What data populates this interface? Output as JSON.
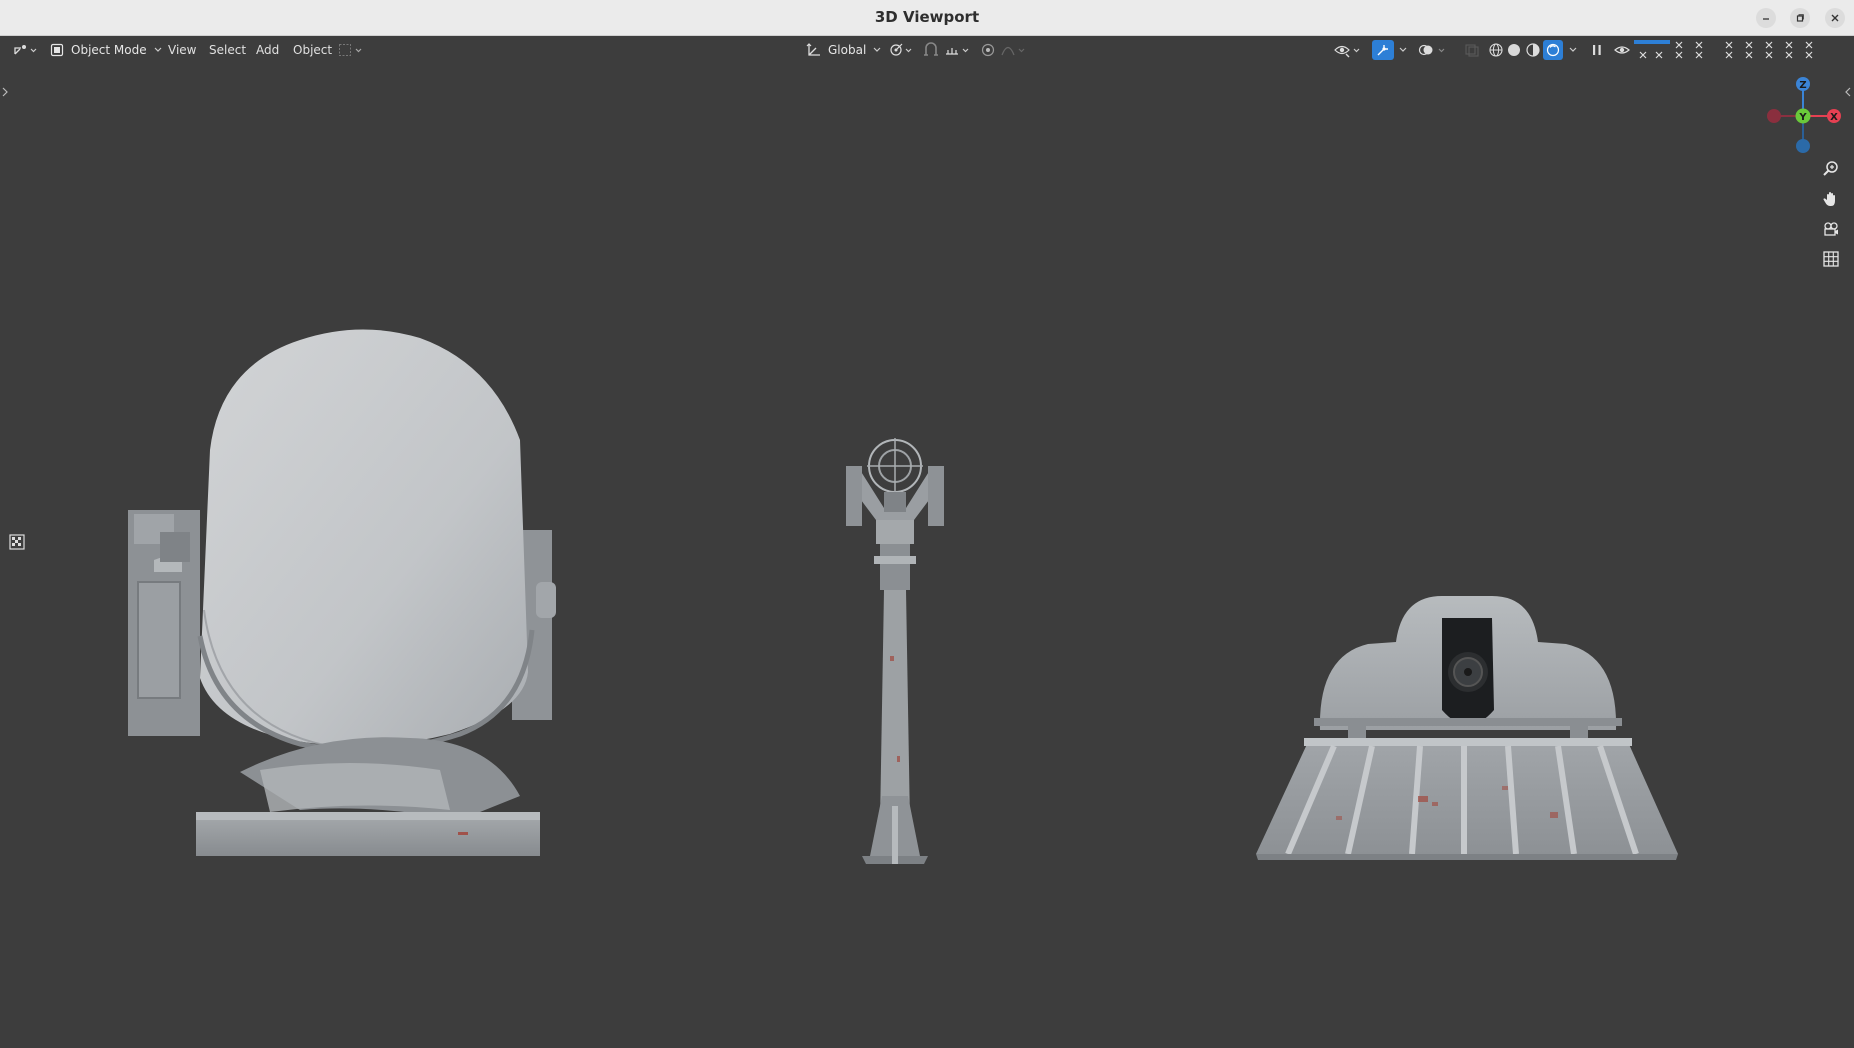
{
  "window": {
    "title": "3D Viewport"
  },
  "header": {
    "mode_label": "Object Mode",
    "menus": [
      "View",
      "Select",
      "Add",
      "Object"
    ],
    "orientation_label": "Global"
  },
  "gizmo": {
    "z_label": "Z",
    "y_label": "Y",
    "x_label": "X"
  },
  "colors": {
    "background": "#3d3d3d",
    "accent": "#2d7fd6",
    "axis_x": "#e64052",
    "axis_y": "#6ac93a",
    "axis_z": "#3b84d6"
  },
  "icons": {
    "editor_type": "editor-type-icon",
    "mode": "object-mode-icon",
    "orientation": "transform-orientation-icon",
    "pivot": "pivot-icon",
    "snap": "snap-icon",
    "proportional": "proportional-edit-icon",
    "visibility": "visibility-icon",
    "gizmo_toggle": "gizmo-toggle-icon",
    "overlays": "overlays-icon",
    "shading": [
      "wireframe-shading-icon",
      "solid-shading-icon",
      "material-shading-icon",
      "rendered-shading-icon"
    ],
    "zoom": "zoom-icon",
    "pan": "pan-icon",
    "camera": "camera-icon",
    "grid": "perspective-grid-icon"
  }
}
